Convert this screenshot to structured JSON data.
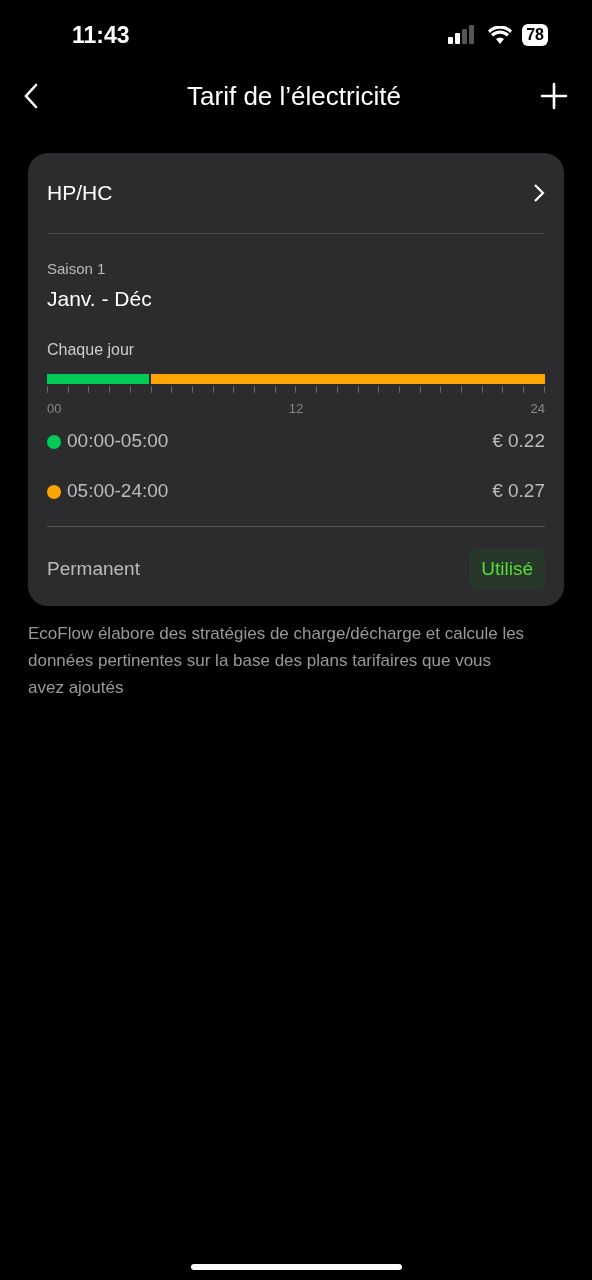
{
  "status_bar": {
    "time": "11:43",
    "battery": "78"
  },
  "header": {
    "title": "Tarif de l’électricité"
  },
  "plan": {
    "name": "HP/HC",
    "season_label": "Saison 1",
    "season_range": "Janv. - Déc",
    "schedule_label": "Chaque jour",
    "timeline": {
      "level": 0.2083
    },
    "tick_labels": [
      "00",
      "12",
      "24"
    ],
    "periods": [
      {
        "range": "00:00-05:00",
        "price": "€ 0.22",
        "color": "#00cc55"
      },
      {
        "range": "05:00-24:00",
        "price": "€ 0.27",
        "color": "#ffa500"
      }
    ],
    "validity": "Permanent",
    "status": "Utilisé"
  },
  "footer_note": "EcoFlow élabore des stratégies de charge/décharge et calcule les données pertinentes sur la base des plans tarifaires que vous avez ajoutés"
}
